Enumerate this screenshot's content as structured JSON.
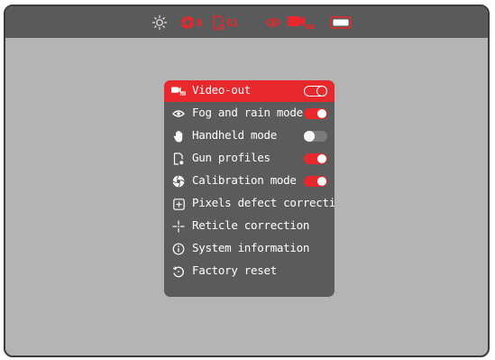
{
  "status_bar": {
    "icons": [
      "brightness-icon",
      "calibration-icon",
      "gun-profile-icon",
      "fog-mode-icon",
      "video-out-icon",
      "battery-icon"
    ],
    "calibration_label": "B",
    "gun_profile_label": "G1",
    "accent_color": "#e8282c"
  },
  "menu": {
    "items": [
      {
        "label": "Video-out",
        "icon": "video-out-icon",
        "toggle": "on",
        "selected": true
      },
      {
        "label": "Fog and rain mode",
        "icon": "eye-icon",
        "toggle": "on"
      },
      {
        "label": "Handheld mode",
        "icon": "hand-icon",
        "toggle": "off"
      },
      {
        "label": "Gun profiles",
        "icon": "gun-profile-icon",
        "toggle": "on"
      },
      {
        "label": "Calibration mode",
        "icon": "aperture-icon",
        "toggle": "on"
      },
      {
        "label": "Pixels defect correction",
        "icon": "plus-square-icon"
      },
      {
        "label": "Reticle correction",
        "icon": "crosshair-icon"
      },
      {
        "label": "System information",
        "icon": "info-icon"
      },
      {
        "label": "Factory reset",
        "icon": "reset-icon"
      }
    ]
  }
}
